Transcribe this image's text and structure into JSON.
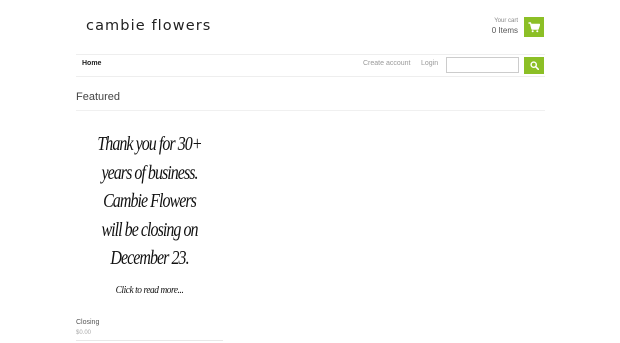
{
  "header": {
    "logo": "cambie flowers",
    "cart_label": "Your cart",
    "cart_count": "0 Items"
  },
  "nav": {
    "home": "Home",
    "create_account": "Create account",
    "login": "Login",
    "search_placeholder": ""
  },
  "featured": {
    "title": "Featured",
    "poster_lines": [
      "Thank you for 30+",
      "years of business.",
      "Cambie Flowers",
      "will be closing on",
      "December 23."
    ],
    "poster_link": "Click to read more...",
    "product_title": "Closing",
    "product_price": "$0.00"
  },
  "colors": {
    "accent": "#8cbf26"
  },
  "icons": {
    "cart": "cart-icon",
    "search": "search-icon"
  }
}
